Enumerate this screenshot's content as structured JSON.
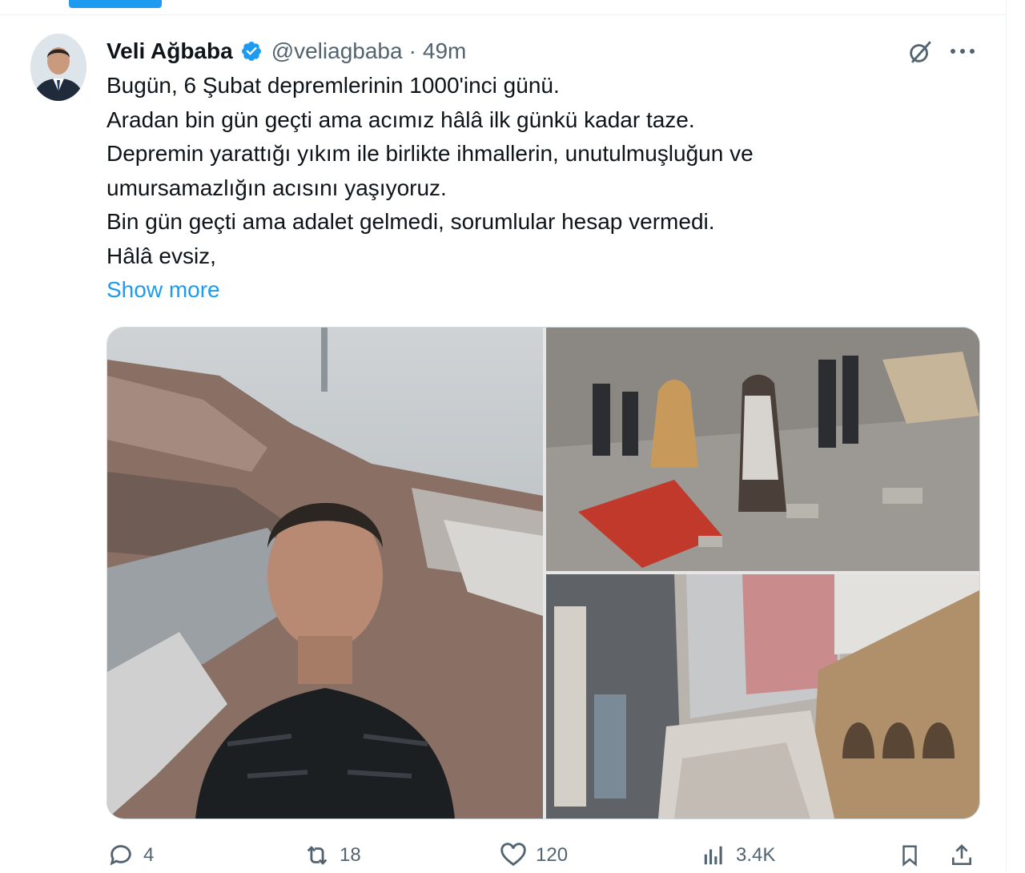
{
  "tweet": {
    "author_name": "Veli Ağbaba",
    "handle": "@veliagbaba",
    "separator": "·",
    "time": "49m",
    "lines": [
      "Bugün, 6 Şubat depremlerinin 1000'inci günü.",
      "Aradan bin gün geçti ama acımız hâlâ ilk günkü kadar taze.",
      "Depremin yarattığı yıkım ile birlikte ihmallerin, unutulmuşluğun ve",
      "umursamazlığın acısını yaşıyoruz.",
      "Bin gün geçti ama adalet gelmedi, sorumlular hesap vermedi.",
      "Hâlâ evsiz,"
    ],
    "show_more": "Show more"
  },
  "metrics": {
    "replies": "4",
    "reposts": "18",
    "likes": "120",
    "views": "3.4K"
  },
  "colors": {
    "accent": "#1d9bf0",
    "text": "#0f1419",
    "muted": "#536471",
    "border": "#cfd9de"
  },
  "icons": {
    "verified": "verified-badge-icon",
    "grok": "grok-icon",
    "more": "more-dots-icon",
    "reply": "reply-icon",
    "repost": "repost-icon",
    "like": "heart-icon",
    "views": "views-chart-icon",
    "bookmark": "bookmark-icon",
    "share": "share-icon"
  }
}
